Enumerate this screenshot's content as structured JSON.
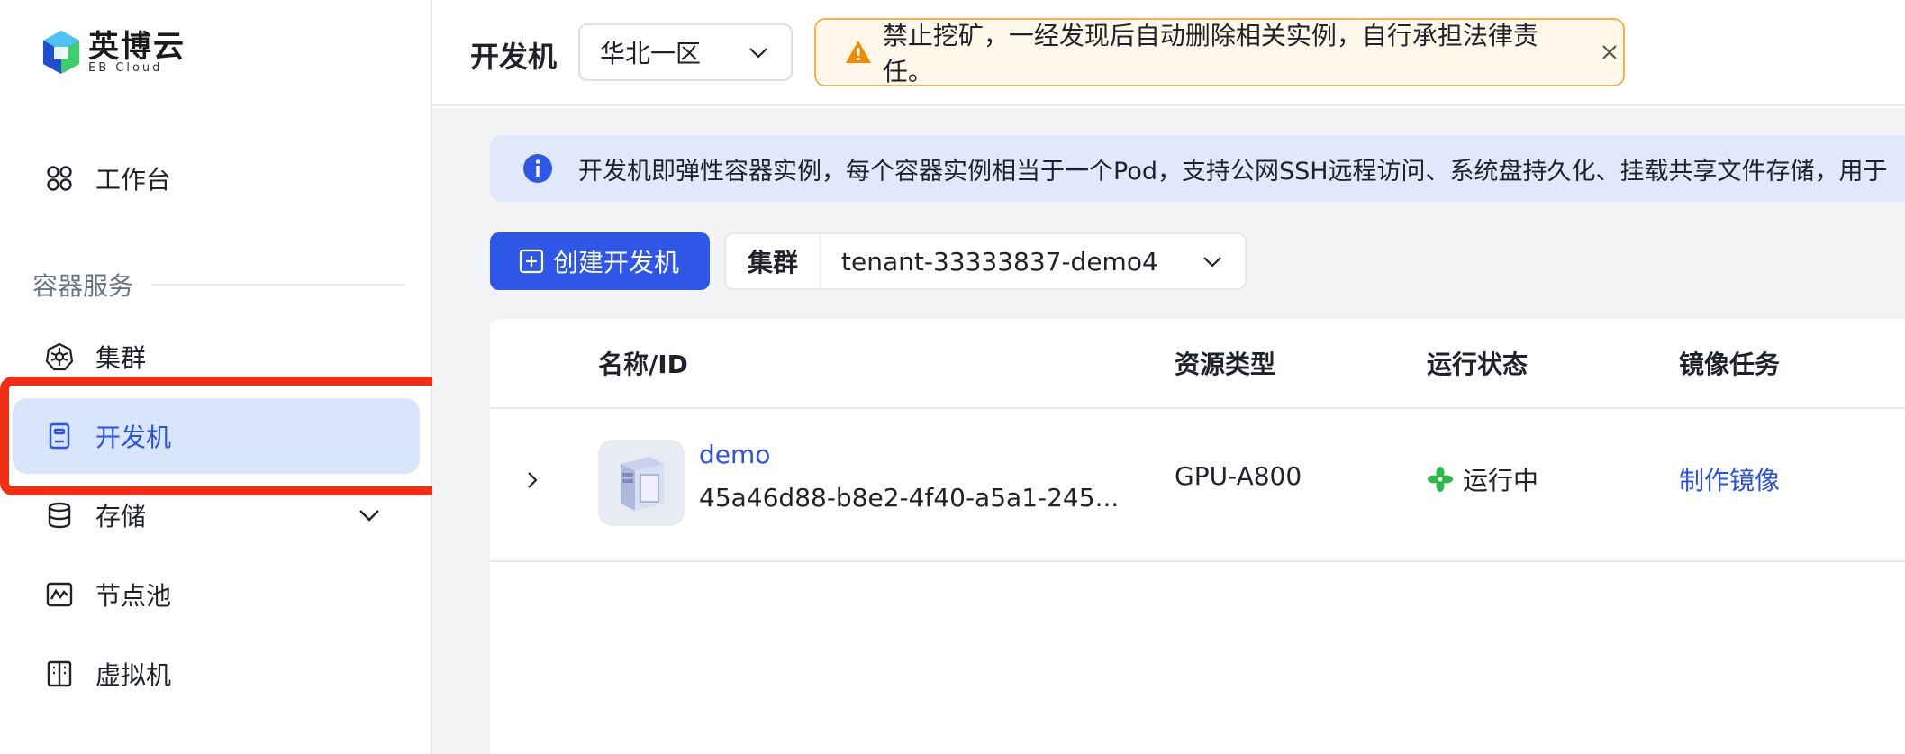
{
  "sidebar": {
    "logo": {
      "cn": "英博云",
      "en": "EB Cloud"
    },
    "workspace": {
      "label": "工作台",
      "icon": "workspace-icon"
    },
    "section_title": "容器服务",
    "items": [
      {
        "label": "集群",
        "icon": "kubernetes-icon"
      },
      {
        "label": "开发机",
        "icon": "devbox-icon",
        "active": true
      },
      {
        "label": "存储",
        "icon": "database-icon",
        "expandable": true
      },
      {
        "label": "节点池",
        "icon": "node-pool-icon"
      },
      {
        "label": "虚拟机",
        "icon": "vm-icon"
      }
    ]
  },
  "header": {
    "title": "开发机",
    "region": "华北一区",
    "warning": "禁止挖矿，一经发现后自动删除相关实例，自行承担法律责任。"
  },
  "main": {
    "info": "开发机即弹性容器实例，每个容器实例相当于一个Pod，支持公网SSH远程访问、系统盘持久化、挂载共享文件存储，用于",
    "create_button": "创建开发机",
    "cluster_label": "集群",
    "cluster_value": "tenant-33333837-demo4",
    "table": {
      "columns": [
        "名称/ID",
        "资源类型",
        "运行状态",
        "镜像任务"
      ],
      "rows": [
        {
          "name": "demo",
          "id": "45a46d88-b8e2-4f40-a5a1-245...",
          "resource": "GPU-A800",
          "status": "运行中",
          "image_task": "制作镜像"
        }
      ]
    }
  },
  "colors": {
    "accent": "#2e57e8",
    "active_bg": "#d7e5fd",
    "highlight": "#f12d14",
    "warning_bg": "#fff7ea",
    "warning_border": "#f7b34c",
    "info_bg": "#dfe9fb",
    "status_green": "#2fb94a"
  }
}
